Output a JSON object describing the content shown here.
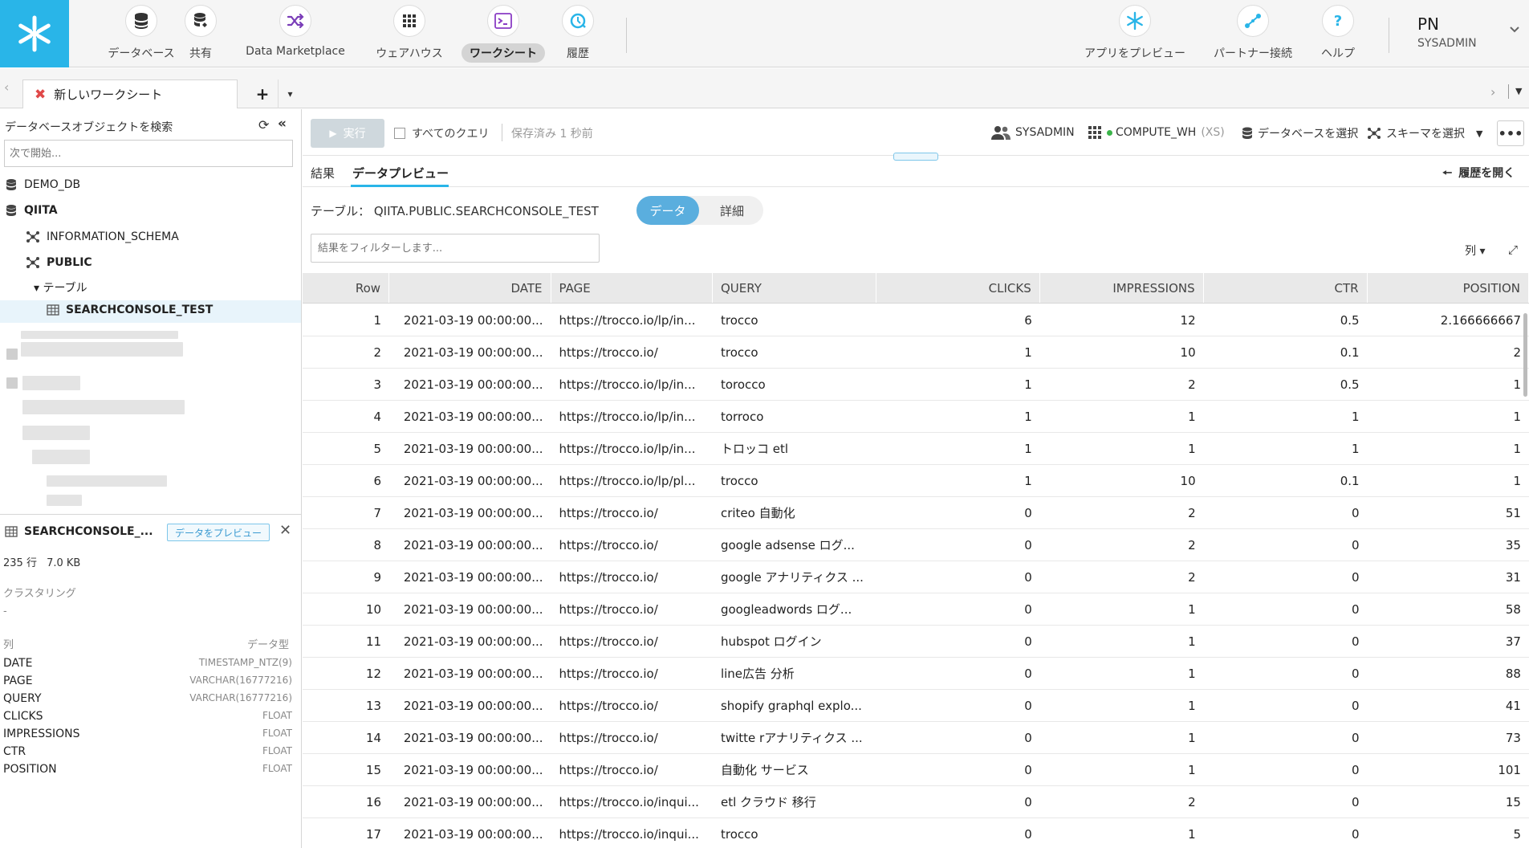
{
  "nav": {
    "items": [
      {
        "label": "データベース",
        "icon": "database-icon"
      },
      {
        "label": "共有",
        "icon": "shared-database-icon"
      },
      {
        "label": "Data Marketplace",
        "icon": "marketplace-icon"
      },
      {
        "label": "ウェアハウス",
        "icon": "warehouse-icon"
      },
      {
        "label": "ワークシート",
        "icon": "worksheet-icon"
      },
      {
        "label": "履歴",
        "icon": "history-icon"
      },
      {
        "label": "アプリをプレビュー",
        "icon": "snowflake-icon"
      },
      {
        "label": "パートナー接続",
        "icon": "partner-connect-icon"
      },
      {
        "label": "ヘルプ",
        "icon": "help-icon"
      }
    ],
    "active": "ワークシート",
    "user_initials": "PN",
    "user_role": "SYSADMIN"
  },
  "worksheet_tab": {
    "title": "新しいワークシート",
    "add": "+",
    "dropdown": "▾"
  },
  "left_panel": {
    "title": "データベースオブジェクトを検索",
    "search_placeholder": "次で開始...",
    "tree": {
      "demo_db": "DEMO_DB",
      "qiita": "QIITA",
      "information_schema": "INFORMATION_SCHEMA",
      "public": "PUBLIC",
      "tables_folder": "▾ テーブル",
      "selected_table": "SEARCHCONSOLE_TEST"
    },
    "detail": {
      "title": "SEARCHCONSOLE_...",
      "preview_button": "データをプレビュー",
      "rows": "235 行",
      "size": "7.0 KB",
      "clustering_label": "クラスタリング",
      "clustering_value": "-",
      "columns_header": "列",
      "type_header": "データ型",
      "columns": [
        {
          "name": "DATE",
          "type": "TIMESTAMP_NTZ(9)"
        },
        {
          "name": "PAGE",
          "type": "VARCHAR(16777216)"
        },
        {
          "name": "QUERY",
          "type": "VARCHAR(16777216)"
        },
        {
          "name": "CLICKS",
          "type": "FLOAT"
        },
        {
          "name": "IMPRESSIONS",
          "type": "FLOAT"
        },
        {
          "name": "CTR",
          "type": "FLOAT"
        },
        {
          "name": "POSITION",
          "type": "FLOAT"
        }
      ]
    }
  },
  "toolbar": {
    "run": "実行",
    "all_queries": "すべてのクエリ",
    "saved": "保存済み 1 秒前",
    "role": "SYSADMIN",
    "warehouse": "COMPUTE_WH",
    "warehouse_size": "(XS)",
    "select_db": "データベースを選択",
    "select_schema": "スキーマを選択",
    "more": "•••"
  },
  "subtabs": {
    "results": "結果",
    "data_preview": "データプレビュー",
    "open_history": "履歴を開く"
  },
  "preview": {
    "table_label": "テーブル： QIITA.PUBLIC.SEARCHCONSOLE_TEST",
    "seg_data": "データ",
    "seg_detail": "詳細",
    "filter_placeholder": "結果をフィルターします...",
    "columns_button": "列 ▾"
  },
  "grid": {
    "headers": [
      "Row",
      "DATE",
      "PAGE",
      "QUERY",
      "CLICKS",
      "IMPRESSIONS",
      "CTR",
      "POSITION"
    ],
    "rows": [
      [
        "1",
        "2021-03-19 00:00:00...",
        "https://trocco.io/lp/in...",
        "trocco",
        "6",
        "12",
        "0.5",
        "2.166666667"
      ],
      [
        "2",
        "2021-03-19 00:00:00...",
        "https://trocco.io/",
        "trocco",
        "1",
        "10",
        "0.1",
        "2"
      ],
      [
        "3",
        "2021-03-19 00:00:00...",
        "https://trocco.io/lp/in...",
        "torocco",
        "1",
        "2",
        "0.5",
        "1"
      ],
      [
        "4",
        "2021-03-19 00:00:00...",
        "https://trocco.io/lp/in...",
        "torroco",
        "1",
        "1",
        "1",
        "1"
      ],
      [
        "5",
        "2021-03-19 00:00:00...",
        "https://trocco.io/lp/in...",
        "トロッコ etl",
        "1",
        "1",
        "1",
        "1"
      ],
      [
        "6",
        "2021-03-19 00:00:00...",
        "https://trocco.io/lp/pl...",
        "trocco",
        "1",
        "10",
        "0.1",
        "1"
      ],
      [
        "7",
        "2021-03-19 00:00:00...",
        "https://trocco.io/",
        "criteo 自動化",
        "0",
        "2",
        "0",
        "51"
      ],
      [
        "8",
        "2021-03-19 00:00:00...",
        "https://trocco.io/",
        "google adsense ログ...",
        "0",
        "2",
        "0",
        "35"
      ],
      [
        "9",
        "2021-03-19 00:00:00...",
        "https://trocco.io/",
        "google アナリティクス ...",
        "0",
        "2",
        "0",
        "31"
      ],
      [
        "10",
        "2021-03-19 00:00:00...",
        "https://trocco.io/",
        "googleadwords ログ...",
        "0",
        "1",
        "0",
        "58"
      ],
      [
        "11",
        "2021-03-19 00:00:00...",
        "https://trocco.io/",
        "hubspot ログイン",
        "0",
        "1",
        "0",
        "37"
      ],
      [
        "12",
        "2021-03-19 00:00:00...",
        "https://trocco.io/",
        "line広告 分析",
        "0",
        "1",
        "0",
        "88"
      ],
      [
        "13",
        "2021-03-19 00:00:00...",
        "https://trocco.io/",
        "shopify graphql explo...",
        "0",
        "1",
        "0",
        "41"
      ],
      [
        "14",
        "2021-03-19 00:00:00...",
        "https://trocco.io/",
        "twitte rアナリティクス ...",
        "0",
        "1",
        "0",
        "73"
      ],
      [
        "15",
        "2021-03-19 00:00:00...",
        "https://trocco.io/",
        "自動化 サービス",
        "0",
        "1",
        "0",
        "101"
      ],
      [
        "16",
        "2021-03-19 00:00:00...",
        "https://trocco.io/inqui...",
        "etl クラウド 移行",
        "0",
        "2",
        "0",
        "15"
      ],
      [
        "17",
        "2021-03-19 00:00:00...",
        "https://trocco.io/inqui...",
        "trocco",
        "0",
        "1",
        "0",
        "5"
      ]
    ]
  },
  "colors": {
    "brand": "#29b5e8",
    "active_segment": "#5aaede",
    "warehouse_status": "#3bb44a",
    "close_tab": "#e04848"
  }
}
